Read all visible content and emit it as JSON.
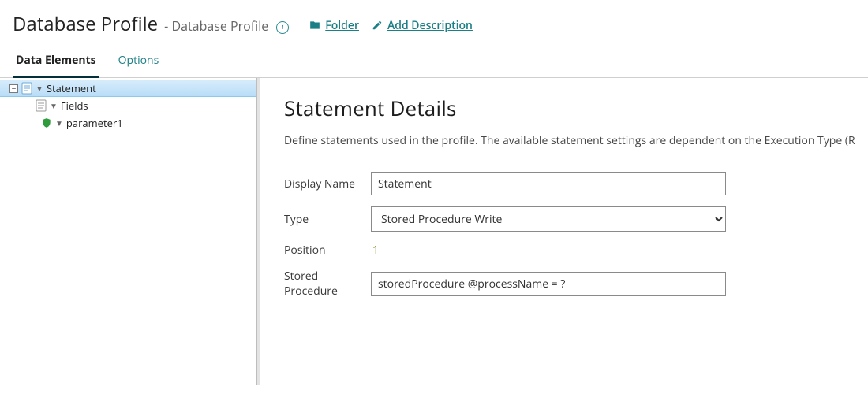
{
  "header": {
    "title": "Database Profile",
    "subtitle": "- Database Profile",
    "folder_label": "Folder",
    "description_label": "Add Description"
  },
  "tabs": {
    "data_elements": "Data Elements",
    "options": "Options"
  },
  "tree": {
    "statement": "Statement",
    "fields": "Fields",
    "parameter1": "parameter1"
  },
  "details": {
    "title": "Statement Details",
    "description": "Define statements used in the profile. The available statement settings are dependent on the Execution Type (R",
    "labels": {
      "display_name": "Display Name",
      "type": "Type",
      "position": "Position",
      "stored_procedure": "Stored Procedure"
    },
    "values": {
      "display_name": "Statement",
      "type": "Stored Procedure Write",
      "position": "1",
      "stored_procedure": "storedProcedure @processName = ?"
    }
  }
}
